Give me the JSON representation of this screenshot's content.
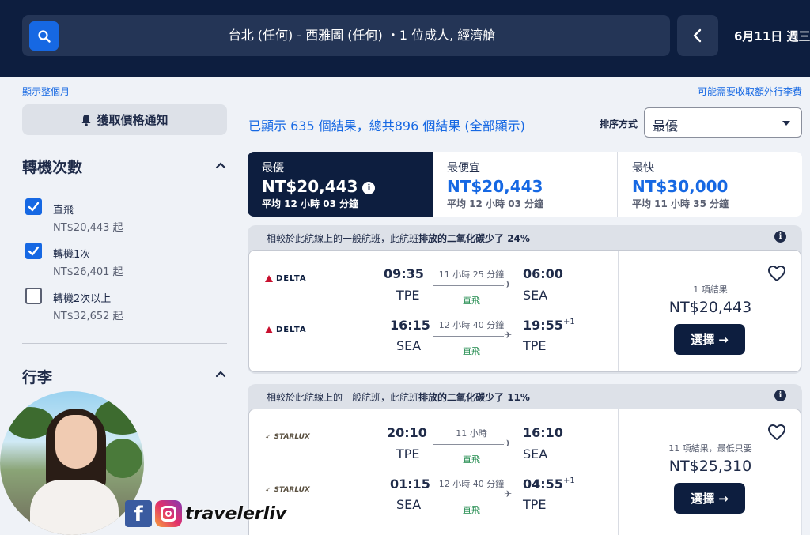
{
  "search": {
    "query": "台北 (任何) - 西雅圖 (任何) ・1 位成人, 經濟艙",
    "date": "6月11日 週三"
  },
  "links": {
    "show_month": "顯示整個月",
    "baggage_fees": "可能需要收取額外行李費"
  },
  "sidebar": {
    "price_alert": "獲取價格通知",
    "stops_title": "轉機次數",
    "stops": [
      {
        "label": "直飛",
        "price": "NT$20,443 起",
        "checked": true
      },
      {
        "label": "轉機1次",
        "price": "NT$26,401 起",
        "checked": true
      },
      {
        "label": "轉機2次以上",
        "price": "NT$32,652 起",
        "checked": false
      }
    ],
    "baggage_title": "行李"
  },
  "results": {
    "count_text": "已顯示 635 個結果，總共896 個結果 (全部顯示)",
    "sort_label": "排序方式",
    "sort_value": "最優"
  },
  "tabs": [
    {
      "title": "最優",
      "price": "NT$20,443",
      "sub": "平均 12 小時 03 分鐘",
      "info": "i"
    },
    {
      "title": "最便宜",
      "price": "NT$20,443",
      "sub": "平均 12 小時 03 分鐘"
    },
    {
      "title": "最快",
      "price": "NT$30,000",
      "sub": "平均 11 小時 35 分鐘"
    }
  ],
  "cards": [
    {
      "eco_prefix": "相較於此航線上的一般航班，此航班",
      "eco_bold": "排放的二氧化碳少了 24%",
      "eco_info": "i",
      "legs": [
        {
          "airline": "DELTA",
          "dep_time": "09:35",
          "dep_code": "TPE",
          "duration": "11 小時 25 分鐘",
          "stops": "直飛",
          "arr_time": "06:00",
          "arr_sup": "",
          "arr_code": "SEA"
        },
        {
          "airline": "DELTA",
          "dep_time": "16:15",
          "dep_code": "SEA",
          "duration": "12 小時 40 分鐘",
          "stops": "直飛",
          "arr_time": "19:55",
          "arr_sup": "+1",
          "arr_code": "TPE"
        }
      ],
      "price_note": "1 項結果",
      "price": "NT$20,443",
      "select": "選擇"
    },
    {
      "eco_prefix": "相較於此航線上的一般航班，此航班",
      "eco_bold": "排放的二氧化碳少了 11%",
      "eco_info": "i",
      "legs": [
        {
          "airline": "STARLUX",
          "dep_time": "20:10",
          "dep_code": "TPE",
          "duration": "11 小時",
          "stops": "直飛",
          "arr_time": "16:10",
          "arr_sup": "",
          "arr_code": "SEA"
        },
        {
          "airline": "STARLUX",
          "dep_time": "01:15",
          "dep_code": "SEA",
          "duration": "12 小時 40 分鐘",
          "stops": "直飛",
          "arr_time": "04:55",
          "arr_sup": "+1",
          "arr_code": "TPE"
        }
      ],
      "price_note": "11 項結果，最低只要",
      "price": "NT$25,310",
      "select": "選擇"
    }
  ],
  "watermark": {
    "handle": "travelerliv",
    "fb_glyph": "f"
  },
  "colors": {
    "header_bg": "#0d1e3f",
    "accent": "#1668e3",
    "nonstop": "#1f8a4c",
    "delta_red": "#c8102e"
  }
}
